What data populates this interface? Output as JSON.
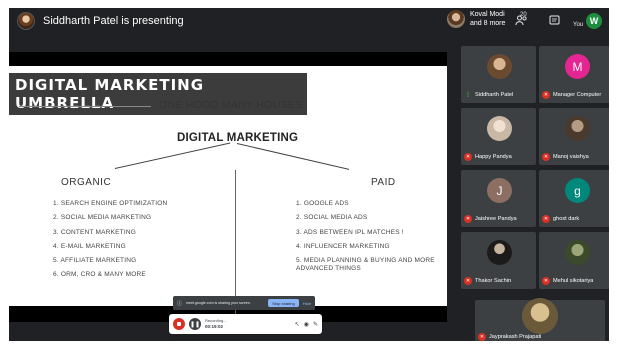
{
  "presenter": {
    "text": "Siddharth Patel is presenting"
  },
  "header": {
    "participants_chip": {
      "line1": "Koval Modi",
      "line2": "and 8 more"
    },
    "people_icon": "people-icon",
    "people_count": "20",
    "chat_icon": "chat-icon",
    "you_label": "You",
    "user_initial": "W"
  },
  "slide": {
    "title": "DIGITAL MARKETING UMBRELLA",
    "subtitle": "ONE HOOD MANY HOUSES",
    "heading": "DIGITAL MARKETING",
    "organic": {
      "title": "ORGANIC",
      "items": [
        "1. SEARCH ENGINE OPTIMIZATION",
        "2. SOCIAL MEDIA MARKETING",
        "3. CONTENT MARKETING",
        "4. E-MAIL MARKETING",
        "5. AFFILIATE MARKETING",
        "6. ORM, CRO & MANY MORE"
      ]
    },
    "paid": {
      "title": "PAID",
      "items": [
        "1. GOOGLE ADS",
        "2. SOCIAL MEDIA ADS",
        "3. ADS BETWEEN IPL MATCHES !",
        "4. INFLUENCER MARKETING",
        "5. MEDIA PLANNING & BUYING AND MORE ADVANCED THINGS"
      ]
    }
  },
  "share_bar": {
    "message": "meet.google.com is sharing your screen.",
    "stop_label": "Stop sharing",
    "hide_label": "Hide"
  },
  "recording": {
    "label": "Recording...",
    "time": "00:19:02"
  },
  "participants": [
    {
      "name": "Siddharth Patel",
      "initial": "",
      "avatar_color": "#6b4a30",
      "muted": false
    },
    {
      "name": "Manager Computer",
      "initial": "M",
      "avatar_color": "#e52592",
      "muted": true
    },
    {
      "name": "Happy Pandya",
      "initial": "",
      "avatar_color": "#c9b8a6",
      "muted": true
    },
    {
      "name": "Manoj vaishya",
      "initial": "",
      "avatar_color": "#7d6a5a",
      "muted": true
    },
    {
      "name": "Jaishree Pandya",
      "initial": "J",
      "avatar_color": "#8d6e63",
      "muted": true
    },
    {
      "name": "ghost dark",
      "initial": "g",
      "avatar_color": "#00897b",
      "muted": true
    },
    {
      "name": "Thakor Sachin",
      "initial": "",
      "avatar_color": "#2b2b2b",
      "muted": true
    },
    {
      "name": "Mehul sikotariya",
      "initial": "",
      "avatar_color": "#4a5a3a",
      "muted": true
    },
    {
      "name": "Jayprakash Prajapati",
      "initial": "",
      "avatar_color": "#a08a5a",
      "muted": true
    }
  ]
}
